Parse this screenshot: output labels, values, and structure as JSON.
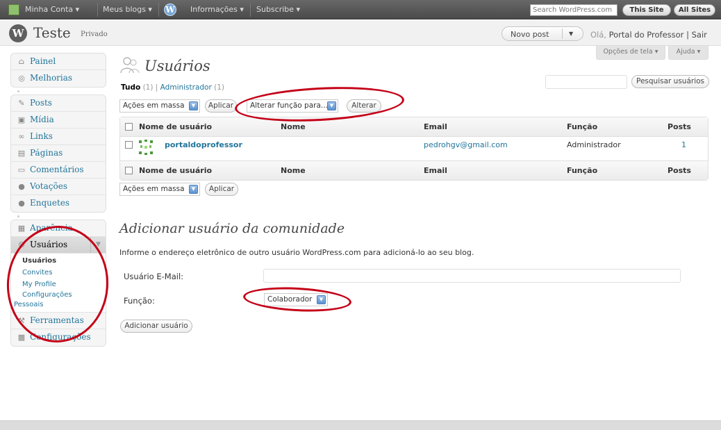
{
  "adminbar": {
    "my_account": "Minha Conta ▾",
    "my_blogs": "Meus blogs ▾",
    "info": "Informações ▾",
    "subscribe": "Subscribe ▾",
    "search_placeholder": "Search WordPress.com",
    "this_site": "This Site",
    "all_sites": "All Sites"
  },
  "header": {
    "site_title": "Teste",
    "privacy": "Privado",
    "favorite_action": "Novo post",
    "greeting_prefix": "Olá,",
    "user_link": "Portal do Professor",
    "separator": "|",
    "logout": "Sair"
  },
  "screen_meta": {
    "screen_options": "Opções de tela ▾",
    "help": "Ajuda ▾"
  },
  "sidebar": {
    "group1": [
      {
        "label": "Painel",
        "icon": "dashboard-icon"
      },
      {
        "label": "Melhorias",
        "icon": "upgrades-icon"
      }
    ],
    "group2": [
      {
        "label": "Posts",
        "icon": "posts-icon"
      },
      {
        "label": "Mídia",
        "icon": "media-icon"
      },
      {
        "label": "Links",
        "icon": "links-icon"
      },
      {
        "label": "Páginas",
        "icon": "pages-icon"
      },
      {
        "label": "Comentários",
        "icon": "comments-icon"
      },
      {
        "label": "Votações",
        "icon": "ratings-icon"
      },
      {
        "label": "Enquetes",
        "icon": "polls-icon"
      }
    ],
    "group3": {
      "appearance": "Aparência",
      "users": "Usuários",
      "users_submenu": [
        "Usuários",
        "Convites",
        "My Profile",
        "Configurações",
        "Pessoais"
      ],
      "tools": "Ferramentas",
      "settings": "Configurações"
    }
  },
  "page": {
    "title": "Usuários",
    "filters": {
      "all_label": "Tudo",
      "all_count": "(1)",
      "separator": "|",
      "admin_label": "Administrador",
      "admin_count": "(1)"
    },
    "search_button": "Pesquisar usuários",
    "bulk_actions": "Ações em massa",
    "apply": "Aplicar",
    "change_role": "Alterar função para...",
    "change": "Alterar",
    "table": {
      "headers": [
        "Nome de usuário",
        "Nome",
        "Email",
        "Função",
        "Posts"
      ],
      "rows": [
        {
          "username": "portaldoprofessor",
          "name": "",
          "email": "pedrohgv@gmail.com",
          "role": "Administrador",
          "posts": "1"
        }
      ]
    }
  },
  "add_user": {
    "title": "Adicionar usuário da comunidade",
    "description": "Informe o endereço eletrônico de outro usuário WordPress.com para adicioná-lo ao seu blog.",
    "email_label": "Usuário E-Mail:",
    "role_label": "Função:",
    "role_value": "Colaborador",
    "submit": "Adicionar usuário"
  },
  "colors": {
    "link": "#21759b",
    "annotation": "#c40017",
    "adminbar": "#4a4a4a"
  }
}
